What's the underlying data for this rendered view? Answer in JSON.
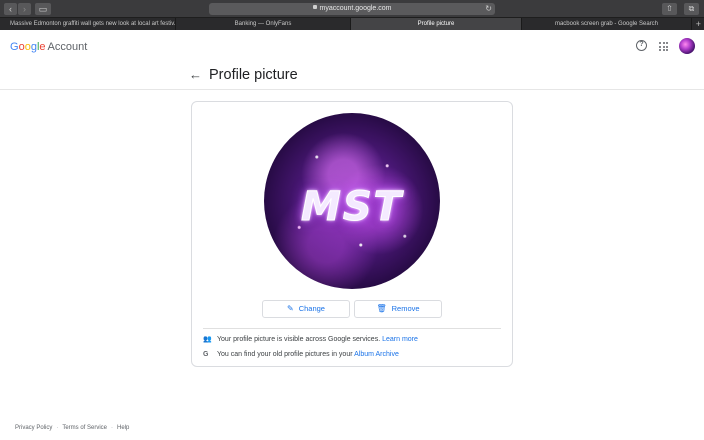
{
  "browser": {
    "url": "myaccount.google.com",
    "tabs": [
      {
        "label": "Massive Edmonton graffiti wall gets new look at local art festiv..."
      },
      {
        "label": "Banking — OnlyFans"
      },
      {
        "label": "Profile picture"
      },
      {
        "label": "macbook screen grab - Google Search"
      }
    ],
    "new_tab": "+"
  },
  "header": {
    "logo": [
      "G",
      "o",
      "o",
      "g",
      "l",
      "e"
    ],
    "account_label": "Account"
  },
  "page": {
    "back_glyph": "←",
    "title": "Profile picture"
  },
  "profile": {
    "image_text": "MST",
    "change_label": "Change",
    "remove_label": "Remove"
  },
  "info": {
    "visibility_text": "Your profile picture is visible across Google services.",
    "learn_more": "Learn more",
    "archive_text": "You can find your old profile pictures in your",
    "archive_link": "Album Archive"
  },
  "footer": {
    "privacy": "Privacy Policy",
    "terms": "Terms of Service",
    "help": "Help",
    "separator": "·"
  },
  "icons": {
    "back": "arrow-left-icon",
    "help": "help-circle-icon",
    "apps": "apps-grid-icon",
    "change": "pencil-icon",
    "remove": "trash-icon",
    "people": "people-icon",
    "google": "google-g-icon"
  },
  "colors": {
    "link": "#1a73e8",
    "google_blue": "#4285f4",
    "google_red": "#ea4335",
    "google_yellow": "#fbbc05",
    "google_green": "#34a853"
  }
}
